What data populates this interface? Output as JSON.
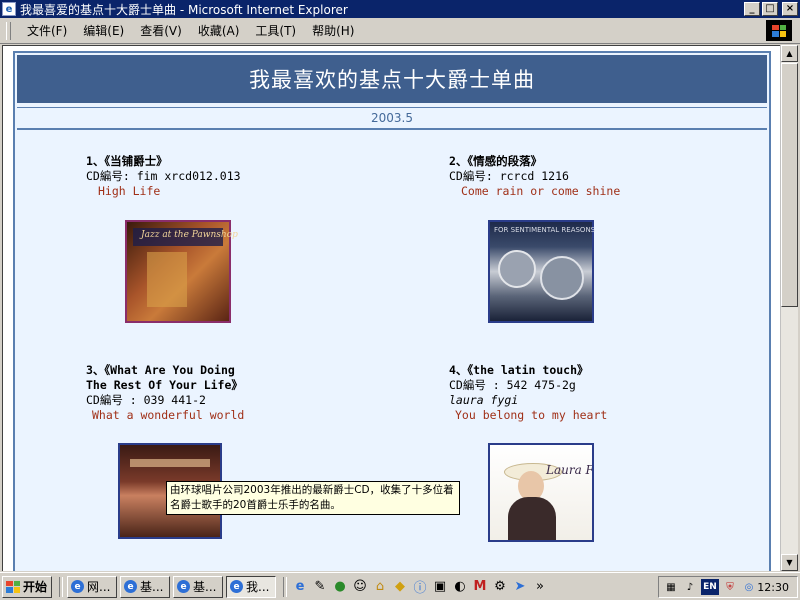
{
  "window": {
    "title": "我最喜爱的基点十大爵士单曲 - Microsoft Internet Explorer",
    "buttons": {
      "minimize": "_",
      "maximize": "□",
      "close": "×"
    }
  },
  "menu": [
    "文件(F)",
    "编辑(E)",
    "查看(V)",
    "收藏(A)",
    "工具(T)",
    "帮助(H)"
  ],
  "page": {
    "heading": "我最喜欢的基点十大爵士单曲",
    "date": "2003.5",
    "albums": [
      {
        "title": "1、《当铺爵士》",
        "cd": "CD編号: fim xrcd012.013",
        "artist": "",
        "song": "High Life"
      },
      {
        "title": "2、《情感的段落》",
        "cd": "CD編号: rcrcd 1216",
        "artist": "",
        "song": "Come rain or come shine"
      },
      {
        "title_line1": "3、《What Are You Doing",
        "title_line2": "The Rest Of Your Life》",
        "cd": "CD編号 :  039 441-2",
        "artist": "",
        "song": "What a wonderful world"
      },
      {
        "title": "4、《the latin touch》",
        "cd": "CD編号 :  542 475-2g",
        "artist": "laura fygi",
        "song": "You belong to my heart"
      }
    ],
    "tooltip": "由环球唱片公司2003年推出的最新爵士CD，收集了十多位着名爵士歌手的20首爵士乐手的名曲。",
    "cover_titles": {
      "album1": "Jazz at the Pawnshop",
      "album2": "FOR SENTIMENTAL REASONS",
      "album4": "Laura Fygi"
    }
  },
  "taskbar": {
    "start": "开始",
    "tasks": [
      "网...",
      "基...",
      "基...",
      "我..."
    ],
    "clock": "12:30",
    "tray_en": "EN"
  },
  "colors": {
    "banner": "#3f5f8e",
    "page_bg": "#ebf4ff",
    "song_text": "#a03018",
    "titlebar": "#0a246a"
  }
}
